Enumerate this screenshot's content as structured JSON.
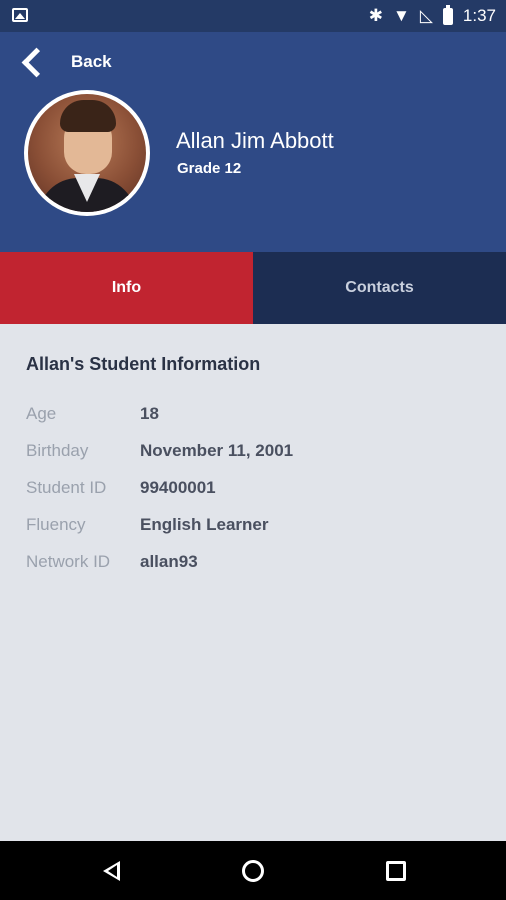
{
  "status_bar": {
    "time": "1:37",
    "icons": [
      "image-icon",
      "bluetooth-icon",
      "wifi-icon",
      "no-signal-icon",
      "battery-icon"
    ]
  },
  "header": {
    "back_label": "Back",
    "student_name": "Allan Jim Abbott",
    "grade": "Grade 12"
  },
  "tabs": [
    {
      "label": "Info",
      "active": true
    },
    {
      "label": "Contacts",
      "active": false
    }
  ],
  "info": {
    "section_title": "Allan's Student Information",
    "rows": [
      {
        "label": "Age",
        "value": "18"
      },
      {
        "label": "Birthday",
        "value": "November 11, 2001"
      },
      {
        "label": "Student ID",
        "value": "99400001"
      },
      {
        "label": "Fluency",
        "value": "English Learner"
      },
      {
        "label": "Network ID",
        "value": "allan93"
      }
    ]
  },
  "colors": {
    "header_bg": "#2f4a86",
    "status_bg": "#243a66",
    "tab_active": "#c12430",
    "tab_inactive": "#1c2d52",
    "content_bg": "#e1e4ea"
  }
}
